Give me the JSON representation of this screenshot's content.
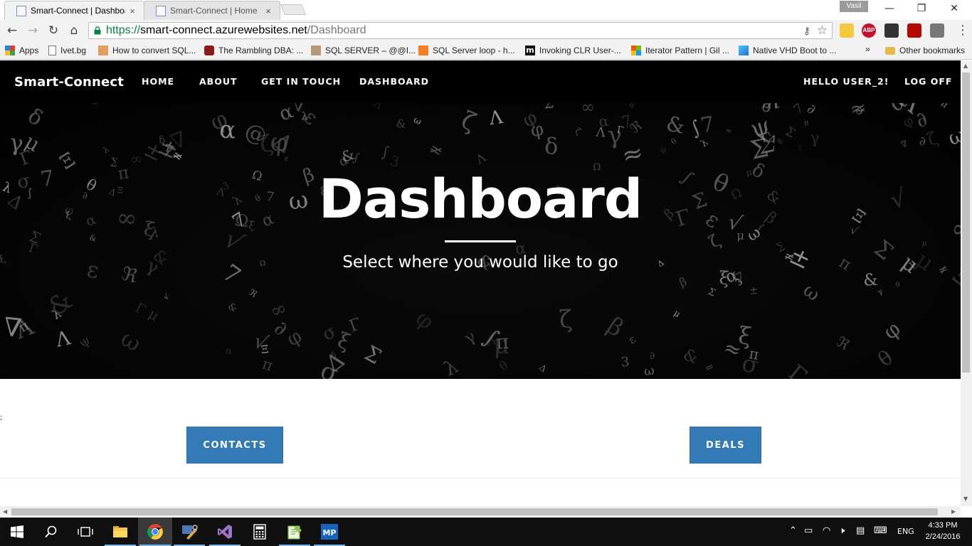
{
  "browser": {
    "tabs": [
      {
        "title": "Smart-Connect | Dashboar",
        "close": "×",
        "active": true
      },
      {
        "title": "Smart-Connect | Home",
        "close": "×",
        "active": false
      }
    ],
    "profile_name": "Vasil",
    "window_controls": {
      "minimize": "—",
      "restore": "❐",
      "close": "✕"
    },
    "toolbar": {
      "back": "←",
      "forward": "→",
      "reload": "↻",
      "home": "⌂"
    },
    "url": {
      "scheme": "https://",
      "host": "smart-connect.azurewebsites.net",
      "path": "/Dashboard"
    },
    "extensions": [
      "ABP"
    ],
    "bookmarks": [
      {
        "label": "Apps",
        "icon": "apps-grid-icon"
      },
      {
        "label": "Ivet.bg",
        "icon": "page-icon"
      },
      {
        "label": "How to convert SQL...",
        "icon": "sql-icon"
      },
      {
        "label": "The Rambling DBA: ...",
        "icon": "blog-icon"
      },
      {
        "label": "SQL SERVER – @@I...",
        "icon": "sqlauthority-icon"
      },
      {
        "label": "SQL Server loop - h...",
        "icon": "stackoverflow-icon"
      },
      {
        "label": "Invoking CLR User-...",
        "icon": "m-icon"
      },
      {
        "label": "Iterator Pattern | Gil ...",
        "icon": "windows-icon"
      },
      {
        "label": "Native VHD Boot to ...",
        "icon": "windows-icon"
      }
    ],
    "bookmarks_overflow": "»",
    "other_bookmarks": "Other bookmarks"
  },
  "site": {
    "brand": "Smart-Connect",
    "nav": [
      "HOME",
      "ABOUT",
      "GET IN TOUCH",
      "DASHBOARD"
    ],
    "greeting": "HELLO USER_2!",
    "logoff": "LOG OFF",
    "hero": {
      "title": "Dashboard",
      "subtitle": "Select where you would like to go"
    },
    "stray_text": ";",
    "buttons": {
      "contacts": "CONTACTS",
      "deals": "DEALS"
    }
  },
  "taskbar": {
    "apps": [
      "start-icon",
      "search-icon",
      "task-view-icon",
      "file-explorer-icon",
      "chrome-icon",
      "tools-icon",
      "visual-studio-icon",
      "calculator-icon",
      "notepad-plus-icon",
      "mp-icon"
    ],
    "active_app": "chrome-icon",
    "language": "ENG",
    "time": "4:33 PM",
    "date": "2/24/2016"
  },
  "colors": {
    "accent": "#337ab7",
    "nav_bg": "#000000",
    "url_secure": "#0b8043"
  }
}
